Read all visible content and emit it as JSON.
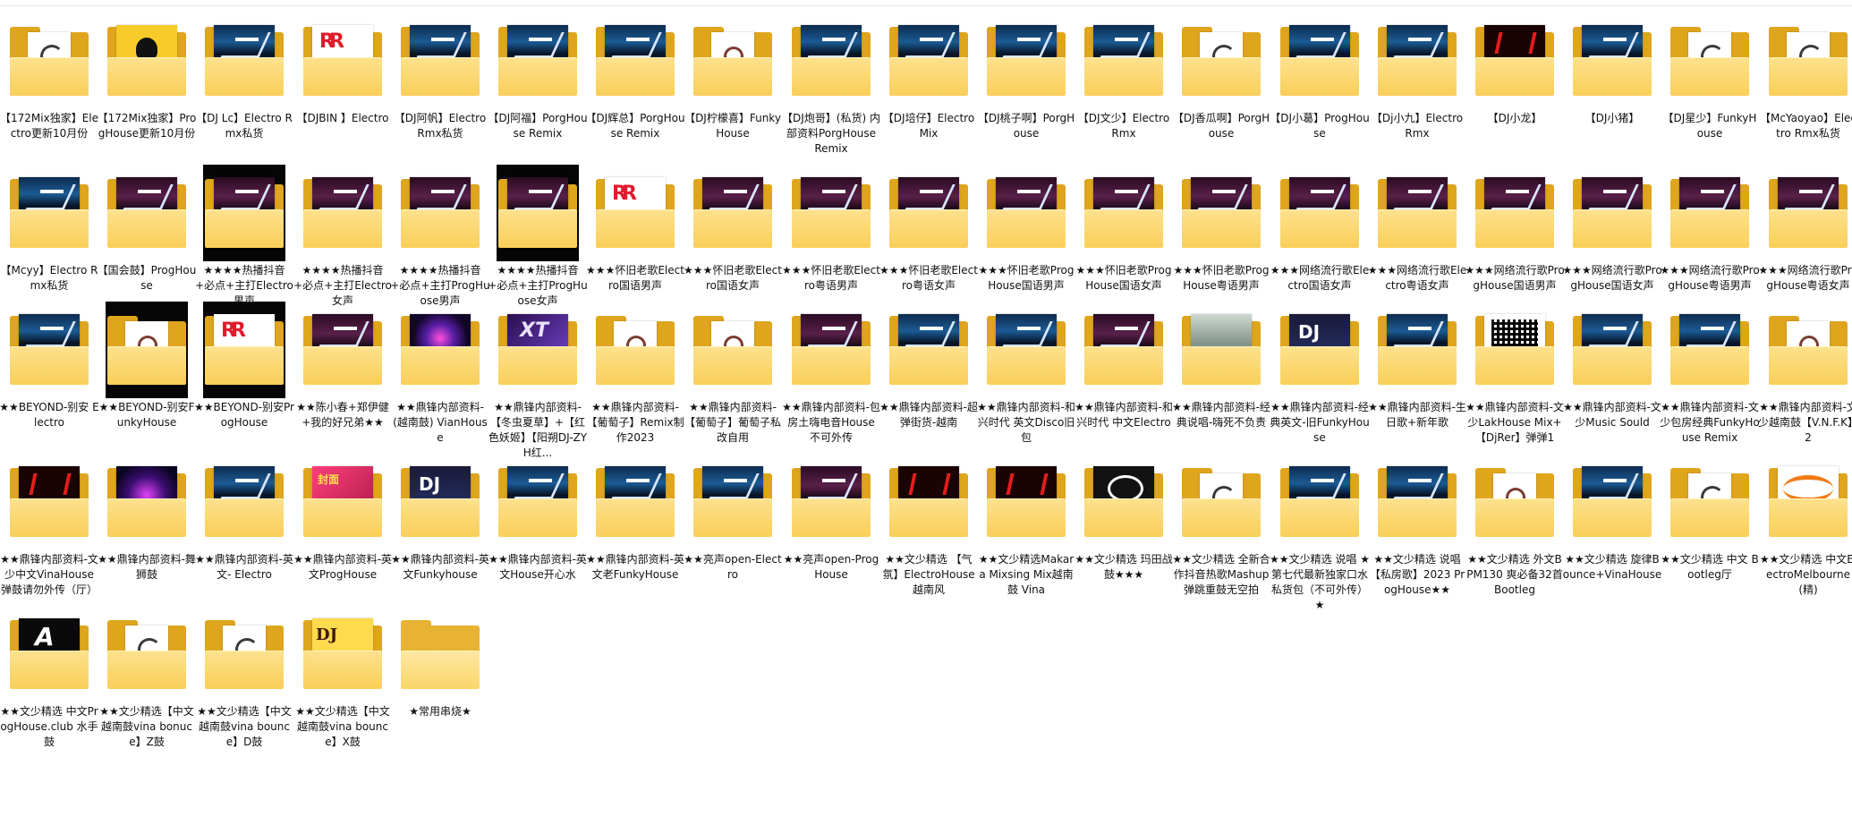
{
  "window": {
    "view": "large-icons"
  },
  "items": [
    {
      "label": "【172Mix独家】Electro更新10月份",
      "preview": "doc"
    },
    {
      "label": "【172Mix独家】ProgHouse更新10月份",
      "preview": "yellowface"
    },
    {
      "label": "【DJ Lc】Electro Rmx私货",
      "preview": "banner"
    },
    {
      "label": "【DJBIN 】Electro",
      "preview": "rb"
    },
    {
      "label": "【DJ阿帆】Electro Rmx私货",
      "preview": "banner"
    },
    {
      "label": "【DJ阿福】PorgHouse Remix",
      "preview": "banner"
    },
    {
      "label": "【DJ辉总】PorgHouse Remix",
      "preview": "banner"
    },
    {
      "label": "【DJ柠檬喜】FunkyHouse",
      "preview": "wdoc"
    },
    {
      "label": "【DJ炮哥】(私货) 内部资料PorgHouse Remix",
      "preview": "banner"
    },
    {
      "label": "【DJ培仔】Electro Mix",
      "preview": "banner"
    },
    {
      "label": "【DJ桃子啊】PorgHouse",
      "preview": "banner"
    },
    {
      "label": "【DJ文少】Electro Rmx",
      "preview": "banner"
    },
    {
      "label": "【DJ香瓜啊】PorgHouse",
      "preview": "doc"
    },
    {
      "label": "【DJ小葛】ProgHouse",
      "preview": "banner"
    },
    {
      "label": "【Dj小九】Electro Rmx",
      "preview": "banner"
    },
    {
      "label": "【DJ小龙】",
      "preview": "red"
    },
    {
      "label": "【DJ小猪】",
      "preview": "banner"
    },
    {
      "label": "【DJ星少】FunkyHouse",
      "preview": "doc"
    },
    {
      "label": "【McYaoyao】Electro Rmx私货",
      "preview": "doc"
    },
    {
      "label": "【Mcyy】Electro Rmx私货",
      "preview": "banner"
    },
    {
      "label": "【国会鼓】ProgHouse",
      "preview": "pink"
    },
    {
      "label": "★★★★热播抖音+必点+主打Electro男声",
      "preview": "pink",
      "dark": true
    },
    {
      "label": "★★★★热播抖音+必点+主打Electro女声",
      "preview": "pink"
    },
    {
      "label": "★★★★热播抖音+必点+主打ProgHuose男声",
      "preview": "pink"
    },
    {
      "label": "★★★★热播抖音+必点+主打ProgHuose女声",
      "preview": "pink",
      "dark": true
    },
    {
      "label": "★★★怀旧老歌Electro国语男声",
      "preview": "rb"
    },
    {
      "label": "★★★怀旧老歌Electro国语女声",
      "preview": "pink"
    },
    {
      "label": "★★★怀旧老歌Electro粤语男声",
      "preview": "pink"
    },
    {
      "label": "★★★怀旧老歌Electro粤语女声",
      "preview": "pink"
    },
    {
      "label": "★★★怀旧老歌ProgHouse国语男声",
      "preview": "pink"
    },
    {
      "label": "★★★怀旧老歌ProgHouse国语女声",
      "preview": "pink"
    },
    {
      "label": "★★★怀旧老歌ProgHouse粤语男声",
      "preview": "pink"
    },
    {
      "label": "★★★网络流行歌Electro国语女声",
      "preview": "pink"
    },
    {
      "label": "★★★网络流行歌Electro粤语女声",
      "preview": "pink"
    },
    {
      "label": "★★★网络流行歌ProgHouse国语男声",
      "preview": "pink"
    },
    {
      "label": "★★★网络流行歌ProgHouse国语女声",
      "preview": "pink"
    },
    {
      "label": "★★★网络流行歌ProgHouse粤语男声",
      "preview": "pink"
    },
    {
      "label": "★★★网络流行歌ProgHouse粤语女声",
      "preview": "pink"
    },
    {
      "label": "★★BEYOND-别安 Electro",
      "preview": "banner"
    },
    {
      "label": "★★BEYOND-别安FunkyHouse",
      "preview": "wdoc",
      "dark": true
    },
    {
      "label": "★★BEYOND-别安ProgHouse",
      "preview": "rb",
      "dark": true
    },
    {
      "label": "★★陈小春+郑伊健+我的好兄弟★★",
      "preview": "pink"
    },
    {
      "label": "★★鼎锋内部资料-(越南鼓) VianHouse",
      "preview": "neon"
    },
    {
      "label": "★★鼎锋内部资料-【冬虫夏草】+【红色妖姬】【阳朔DJ-ZYH红...",
      "preview": "xt"
    },
    {
      "label": "★★鼎锋内部资料-【葡萄子】Remix制作2023",
      "preview": "wdoc"
    },
    {
      "label": "★★鼎锋内部资料-【葡萄子】葡萄子私改自用",
      "preview": "wdoc"
    },
    {
      "label": "★★鼎锋内部资料-包房土嗨电音House 不可外传",
      "preview": "pink"
    },
    {
      "label": "★★鼎锋内部资料-超弹街货-越南",
      "preview": "banner"
    },
    {
      "label": "★★鼎锋内部资料-和兴时代 英文Disco旧包",
      "preview": "banner"
    },
    {
      "label": "★★鼎锋内部资料-和兴时代 中文Electro",
      "preview": "pink"
    },
    {
      "label": "★★鼎锋内部资料-经典说唱-嗨死不负责",
      "preview": "scene"
    },
    {
      "label": "★★鼎锋内部资料-经典英文-旧FunkyHouse",
      "preview": "dj"
    },
    {
      "label": "★★鼎锋内部资料-生日歌+新年歌",
      "preview": "banner"
    },
    {
      "label": "★★鼎锋内部资料-文少LakHouse Mix+【DjRer】弹弹1",
      "preview": "qr"
    },
    {
      "label": "★★鼎锋内部资料-文少Music Sould",
      "preview": "banner"
    },
    {
      "label": "★★鼎锋内部资料-文少包房经典FunkyHouse Remix",
      "preview": "banner"
    },
    {
      "label": "★★鼎锋内部资料-文少越南鼓【V.N.F.K】2",
      "preview": "wdoc"
    },
    {
      "label": "★★鼎锋内部资料-文少中文VinaHouse 弹鼓请勿外传（厅）",
      "preview": "red"
    },
    {
      "label": "★★鼎锋内部资料-舞狮鼓",
      "preview": "neon2"
    },
    {
      "label": "★★鼎锋内部资料-英文- Electro",
      "preview": "banner"
    },
    {
      "label": "★★鼎锋内部资料-英文ProgHouse",
      "preview": "mag"
    },
    {
      "label": "★★鼎锋内部资料-英文Funkyhouse",
      "preview": "dj"
    },
    {
      "label": "★★鼎锋内部资料-英文House开心水",
      "preview": "banner"
    },
    {
      "label": "★★鼎锋内部资料-英文老FunkyHouse",
      "preview": "banner"
    },
    {
      "label": "★★亮声open-Electro",
      "preview": "banner"
    },
    {
      "label": "★★亮声open-ProgHouse",
      "preview": "pink"
    },
    {
      "label": "★★文少精选 【气氛】ElectroHouse越南风",
      "preview": "red"
    },
    {
      "label": "★★文少精选Makara Mixsing Mix越南鼓 Vina",
      "preview": "red"
    },
    {
      "label": "★★文少精选 玛田战鼓★★★",
      "preview": "dark"
    },
    {
      "label": "★★文少精选 全新合作抖音热歌Mashup 弹跳重鼓无空拍",
      "preview": "doc"
    },
    {
      "label": "★★文少精选 说唱 ★第七代最新独家口水私货包（不可外传）★",
      "preview": "banner"
    },
    {
      "label": "★★文少精选 说唱【私房歌】2023 ProgHouse★★",
      "preview": "banner"
    },
    {
      "label": "★★文少精选 外文BPM130 爽必备32首 Bootleg",
      "preview": "wdoc"
    },
    {
      "label": "★★文少精选 旋律Bounce+VinaHouse",
      "preview": "banner"
    },
    {
      "label": "★★文少精选 中文 Bootleg厅",
      "preview": "doc"
    },
    {
      "label": "★★文少精选 中文ElectroMelbourne(精)",
      "preview": "wing"
    },
    {
      "label": "★★文少精选 中文ProgHouse.club 水手鼓",
      "preview": "ax"
    },
    {
      "label": "★★文少精选【中文越南鼓vina bonuce】Z鼓",
      "preview": "doc"
    },
    {
      "label": "★★文少精选【中文越南鼓vina bounce】D鼓",
      "preview": "doc"
    },
    {
      "label": "★★文少精选【中文越南鼓vina bounce】X鼓",
      "preview": "dnb"
    },
    {
      "label": "★常用串烧★",
      "preview": "none"
    }
  ]
}
